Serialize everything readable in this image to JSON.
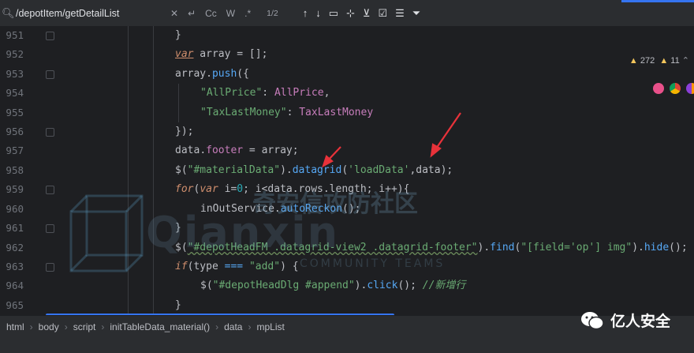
{
  "findbar": {
    "query": "/depotItem/getDetailList",
    "match_count": "1/2",
    "options": [
      "Cc",
      "W",
      ".*"
    ]
  },
  "inspections": {
    "warnings": "272",
    "other": "11"
  },
  "editor": {
    "lines": [
      {
        "n": "951"
      },
      {
        "n": "952"
      },
      {
        "n": "953"
      },
      {
        "n": "954"
      },
      {
        "n": "955"
      },
      {
        "n": "956"
      },
      {
        "n": "957"
      },
      {
        "n": "958"
      },
      {
        "n": "959"
      },
      {
        "n": "960"
      },
      {
        "n": "961"
      },
      {
        "n": "962"
      },
      {
        "n": "963"
      },
      {
        "n": "964"
      },
      {
        "n": "965"
      }
    ],
    "code": {
      "l951": "}",
      "l952": {
        "kw": "var",
        "rest": " array = [];"
      },
      "l953": {
        "id": "array",
        "dot": ".",
        "fn": "push",
        "rest": "({"
      },
      "l954": {
        "key": "\"AllPrice\"",
        "colon": ": ",
        "val": "AllPrice",
        "tail": ","
      },
      "l955": {
        "key": "\"TaxLastMoney\"",
        "colon": ": ",
        "val": "TaxLastMoney"
      },
      "l956": "});",
      "l957": {
        "a": "data",
        "b": ".",
        "c": "footer",
        "d": " = array;"
      },
      "l958": {
        "a": "$(",
        "b": "\"#materialData\"",
        "c": ").",
        "d": "datagrid",
        "e": "(",
        "f": "'loadData'",
        "g": ",data);"
      },
      "l959": {
        "kw": "for",
        "a": "(",
        "kw2": "var",
        "b": " i=",
        "num": "0",
        "c": "; i<data.rows.length; i++){"
      },
      "l960": {
        "a": "inOutService.",
        "b": "autoReckon",
        "c": "();"
      },
      "l961": "}",
      "l962": {
        "a": "$(",
        "b": "\"#depotHeadFM .datagrid-view2 .datagrid-footer\"",
        "c": ").",
        "d": "find",
        "e": "(",
        "f": "\"[field='op'] img\"",
        "g": ").",
        "h": "hide",
        "i": "();"
      },
      "l963": {
        "kw": "if",
        "a": "(type ",
        "op": "===",
        "b": " ",
        "c": "\"add\"",
        "d": ") {"
      },
      "l964": {
        "a": "$(",
        "b": "\"#depotHeadDlg #append\"",
        "c": ").",
        "d": "click",
        "e": "(); ",
        "f": "//新增行"
      },
      "l965": "}"
    }
  },
  "statusbar": {
    "breadcrumbs": [
      "html",
      "body",
      "script",
      "initTableData_material()",
      "data",
      "mpList"
    ]
  },
  "watermark": {
    "cn": "奇安信攻防社区",
    "en": "Qianxin",
    "sub": "COMMUNITY TEAMS"
  },
  "brand": {
    "label": "亿人安全"
  }
}
